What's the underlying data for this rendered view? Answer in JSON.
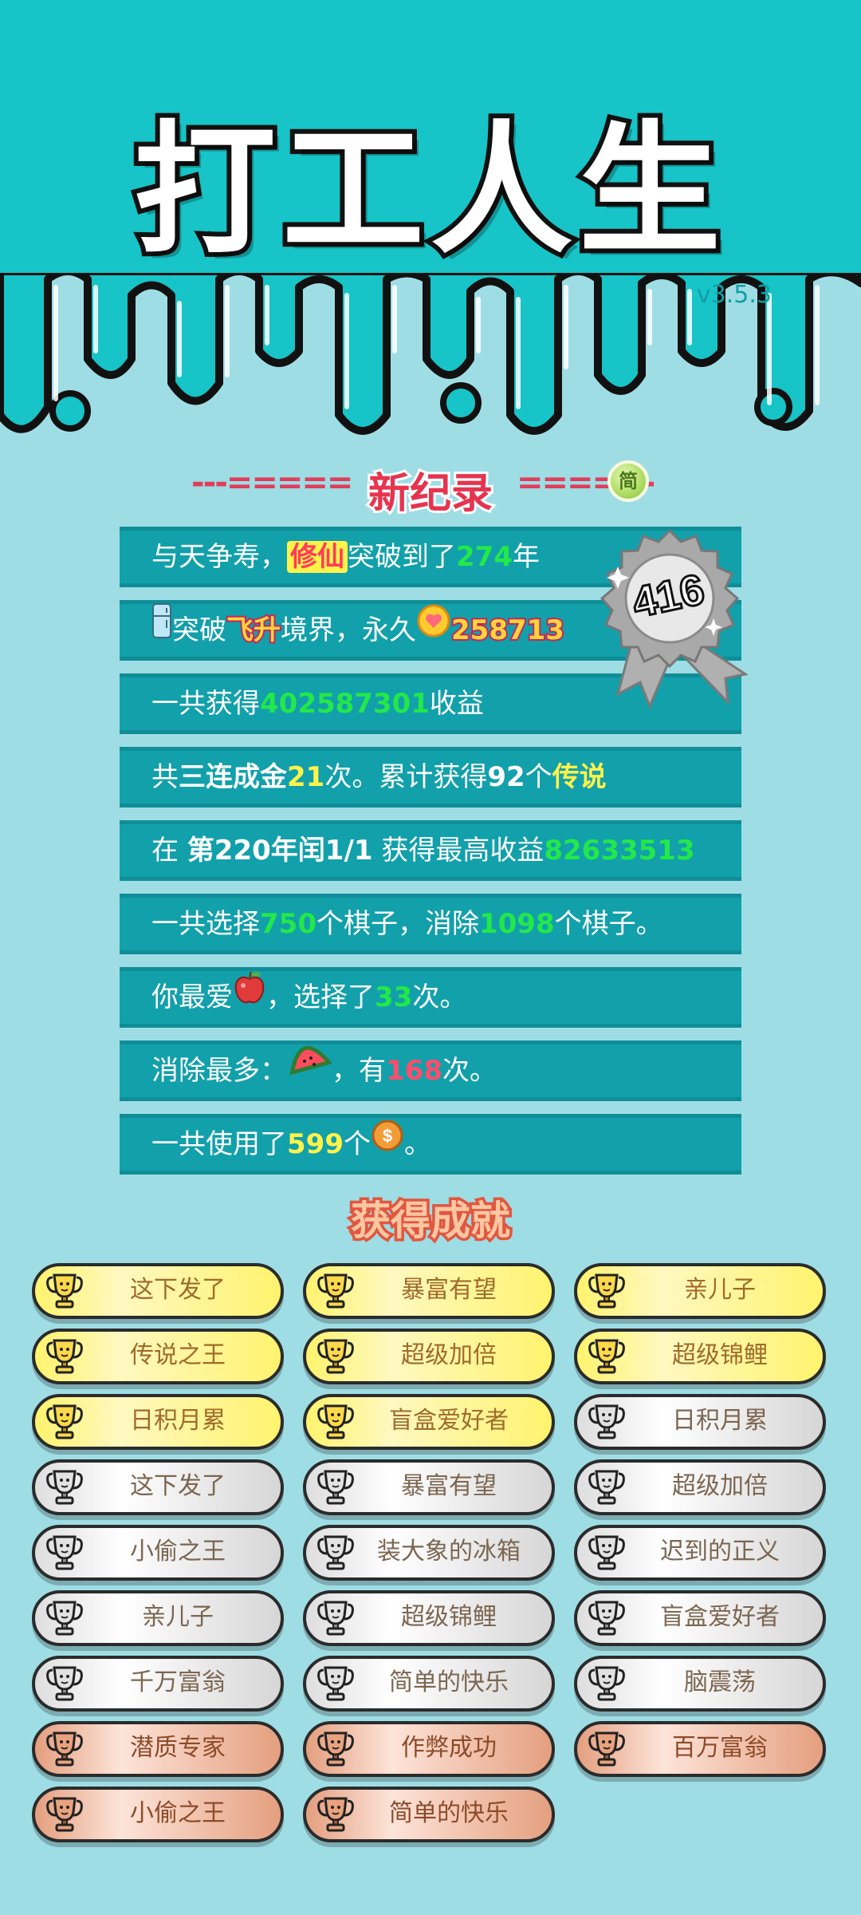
{
  "header": {
    "title": "打工人生",
    "version": "v3.5.3"
  },
  "record": {
    "title": "新纪录",
    "badge_text": "简",
    "award_number": "416"
  },
  "stats": [
    {
      "segments": [
        {
          "t": "与天争寿，",
          "c": ""
        },
        {
          "t": "修仙",
          "c": "hl"
        },
        {
          "t": "突破到了",
          "c": ""
        },
        {
          "t": "274",
          "c": "g"
        },
        {
          "t": "年",
          "c": ""
        }
      ]
    },
    {
      "segments": [
        {
          "icon": "fridge-icon"
        },
        {
          "t": "突破",
          "c": ""
        },
        {
          "t": "飞升",
          "c": "hly"
        },
        {
          "t": "境界，永久",
          "c": ""
        },
        {
          "icon": "heart-coin-icon"
        },
        {
          "t": "258713",
          "c": "hly"
        }
      ]
    },
    {
      "segments": [
        {
          "t": "一共获得",
          "c": ""
        },
        {
          "t": "402587301",
          "c": "g"
        },
        {
          "t": "收益",
          "c": ""
        }
      ]
    },
    {
      "segments": [
        {
          "t": "共",
          "c": ""
        },
        {
          "t": "三连成金",
          "c": "w"
        },
        {
          "t": "21",
          "c": "y"
        },
        {
          "t": "次。累计获得",
          "c": ""
        },
        {
          "t": "92",
          "c": "w"
        },
        {
          "t": "个",
          "c": ""
        },
        {
          "t": "传说",
          "c": "y"
        }
      ]
    },
    {
      "segments": [
        {
          "t": "在 ",
          "c": ""
        },
        {
          "t": "第220年闰1/1",
          "c": "w"
        },
        {
          "t": " 获得最高收益",
          "c": ""
        },
        {
          "t": "82633513",
          "c": "g"
        }
      ]
    },
    {
      "segments": [
        {
          "t": "一共选择",
          "c": ""
        },
        {
          "t": "750",
          "c": "g"
        },
        {
          "t": "个棋子，消除",
          "c": ""
        },
        {
          "t": "1098",
          "c": "g"
        },
        {
          "t": "个棋子。",
          "c": ""
        }
      ]
    },
    {
      "segments": [
        {
          "t": "你最爱",
          "c": ""
        },
        {
          "icon": "apple-icon"
        },
        {
          "t": "，选择了",
          "c": ""
        },
        {
          "t": "33",
          "c": "g"
        },
        {
          "t": "次。",
          "c": ""
        }
      ]
    },
    {
      "segments": [
        {
          "t": "消除最多：",
          "c": ""
        },
        {
          "icon": "watermelon-icon"
        },
        {
          "t": "，有",
          "c": ""
        },
        {
          "t": "168",
          "c": "r"
        },
        {
          "t": "次。",
          "c": ""
        }
      ]
    },
    {
      "segments": [
        {
          "t": "一共使用了",
          "c": ""
        },
        {
          "t": "599",
          "c": "y"
        },
        {
          "t": "个",
          "c": ""
        },
        {
          "icon": "coin-icon"
        },
        {
          "t": "。",
          "c": ""
        }
      ]
    }
  ],
  "achievements_title": "获得成就",
  "achievements": [
    {
      "label": "这下发了",
      "tier": "gold"
    },
    {
      "label": "暴富有望",
      "tier": "gold"
    },
    {
      "label": "亲儿子",
      "tier": "gold"
    },
    {
      "label": "传说之王",
      "tier": "gold"
    },
    {
      "label": "超级加倍",
      "tier": "gold"
    },
    {
      "label": "超级锦鲤",
      "tier": "gold"
    },
    {
      "label": "日积月累",
      "tier": "gold"
    },
    {
      "label": "盲盒爱好者",
      "tier": "gold"
    },
    {
      "label": "日积月累",
      "tier": "silver"
    },
    {
      "label": "这下发了",
      "tier": "silver"
    },
    {
      "label": "暴富有望",
      "tier": "silver"
    },
    {
      "label": "超级加倍",
      "tier": "silver"
    },
    {
      "label": "小偷之王",
      "tier": "silver"
    },
    {
      "label": "装大象的冰箱",
      "tier": "silver"
    },
    {
      "label": "迟到的正义",
      "tier": "silver"
    },
    {
      "label": "亲儿子",
      "tier": "silver"
    },
    {
      "label": "超级锦鲤",
      "tier": "silver"
    },
    {
      "label": "盲盒爱好者",
      "tier": "silver"
    },
    {
      "label": "千万富翁",
      "tier": "silver"
    },
    {
      "label": "简单的快乐",
      "tier": "silver"
    },
    {
      "label": "脑震荡",
      "tier": "silver"
    },
    {
      "label": "潜质专家",
      "tier": "bronze"
    },
    {
      "label": "作弊成功",
      "tier": "bronze"
    },
    {
      "label": "百万富翁",
      "tier": "bronze"
    },
    {
      "label": "小偷之王",
      "tier": "bronze"
    },
    {
      "label": "简单的快乐",
      "tier": "bronze"
    }
  ],
  "colors": {
    "header_bg": "#17c4c7",
    "page_bg": "#9fdde5",
    "row_bg": "#12a0ab",
    "accent_red": "#e6344f"
  }
}
